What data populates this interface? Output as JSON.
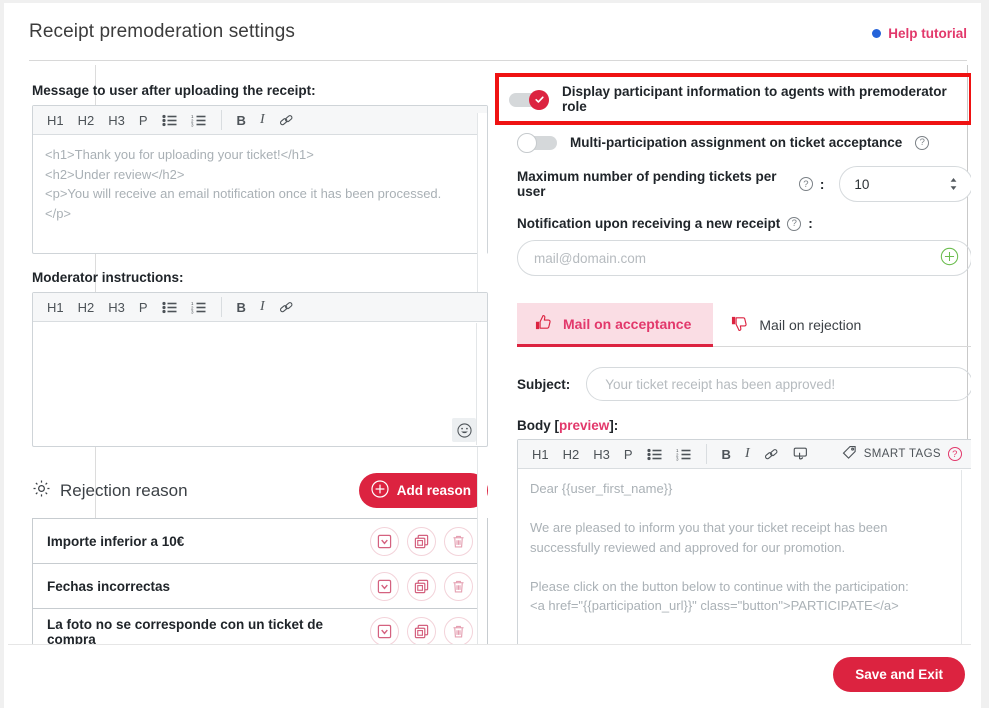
{
  "header": {
    "title": "Receipt premoderation settings",
    "help_label": "Help tutorial"
  },
  "editor_toolbar": {
    "h1": "H1",
    "h2": "H2",
    "h3": "H3",
    "p": "P",
    "bullet_list": "bullet-list-icon",
    "numbered_list": "numbered-list-icon",
    "bold": "B",
    "italic": "I",
    "link": "link-icon",
    "button_tag": "button-tag-icon",
    "smart_tags_label": "SMART TAGS",
    "help": "?"
  },
  "left": {
    "message_label": "Message to user after uploading the receipt:",
    "message_value": "<h1>Thank you for uploading your ticket!</h1>\n<h2>Under review</h2>\n<p>You will receive an email notification once it has been processed.\n</p>",
    "moderator_label": "Moderator instructions:",
    "moderator_value": "",
    "emoji_icon": "smiley-icon",
    "rejection_title": "Rejection reason",
    "gear_icon": "gear-icon",
    "add_reason_label": "Add reason",
    "reasons": [
      {
        "label": "Importe inferior a 10€"
      },
      {
        "label": "Fechas incorrectas"
      },
      {
        "label": "La foto no se corresponde con un ticket de compra"
      }
    ],
    "row_actions": {
      "expand": "chevron-down-box-icon",
      "duplicate": "duplicate-icon",
      "delete": "trash-icon"
    }
  },
  "right": {
    "toggle_display_label": "Display participant information to agents with premoderator role",
    "toggle_display_on": true,
    "toggle_multi_label": "Multi-participation assignment on ticket acceptance",
    "toggle_multi_on": false,
    "max_tickets_label": "Maximum number of pending tickets per user",
    "max_tickets_colon": ":",
    "max_tickets_value": "10",
    "notification_label": "Notification upon receiving a new receipt",
    "notification_colon": ":",
    "notification_placeholder": "mail@domain.com",
    "add_mail_icon": "plus-circle-icon",
    "tabs": [
      {
        "label": "Mail on acceptance",
        "icon": "thumbs-up-icon",
        "active": true
      },
      {
        "label": "Mail on rejection",
        "icon": "thumbs-down-icon",
        "active": false
      }
    ],
    "subject_label": "Subject:",
    "subject_placeholder": "Your ticket receipt has been approved!",
    "body_label": "Body",
    "body_preview_label": "preview",
    "body_bracket_open": "[",
    "body_bracket_close": "]:",
    "body_value": "Dear {{user_first_name}}\n\nWe are pleased to inform you that your ticket receipt has been\nsuccessfully reviewed and approved for our promotion.\n\nPlease click on the button below to continue with the participation:\n<a href=\"{{participation_url}}\" class=\"button\">PARTICIPATE</a>"
  },
  "footer": {
    "save_label": "Save and Exit"
  },
  "colors": {
    "brand_red": "#dc2340",
    "pink_accent": "#e2386b",
    "highlight_border": "#ef1212",
    "blue_dot": "#2563d9",
    "green_plus": "#6bbd4e"
  }
}
